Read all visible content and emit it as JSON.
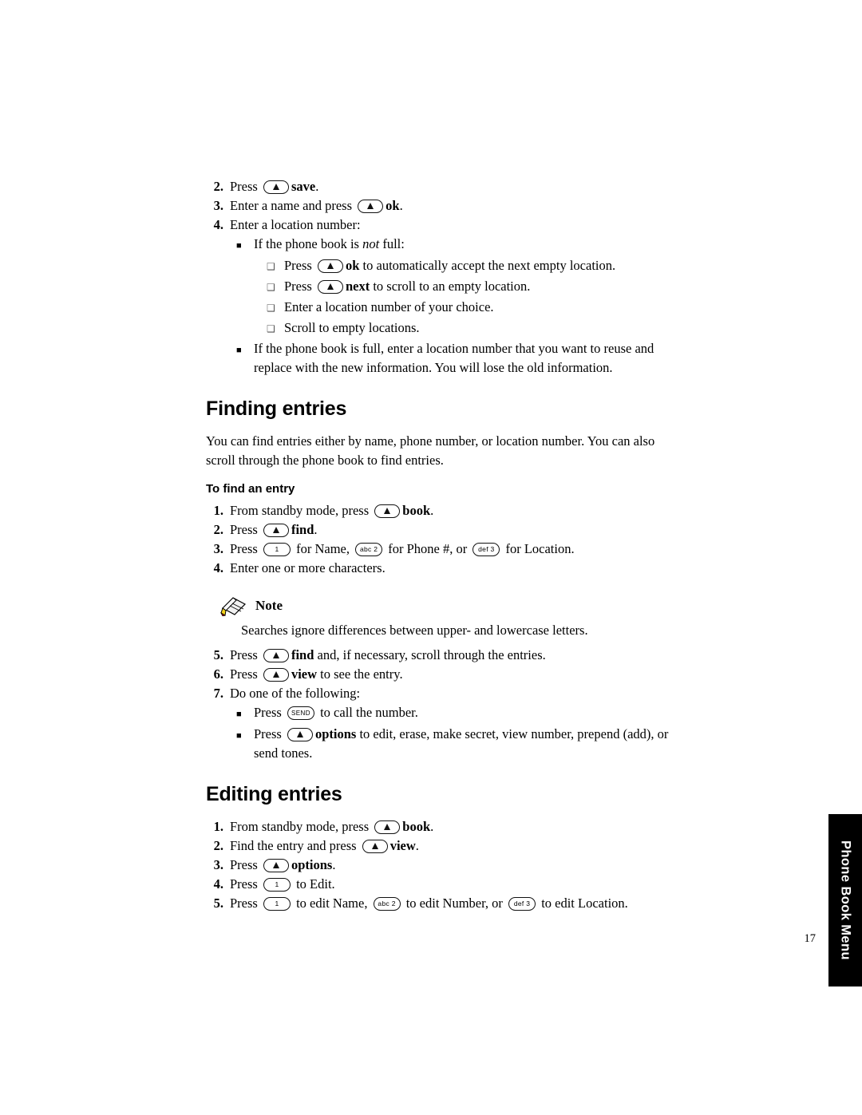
{
  "page": {
    "number": "17",
    "side_tab_label": "Phone Book Menu"
  },
  "steps_top": [
    {
      "num": "2.",
      "pre": "Press",
      "key": "nav",
      "bold": "save",
      "post": "."
    },
    {
      "num": "3.",
      "pre": "Enter a name and press",
      "key": "nav",
      "bold": "ok",
      "post": "."
    },
    {
      "num": "4.",
      "pre": "Enter a location number:",
      "key": "",
      "bold": "",
      "post": ""
    }
  ],
  "sub_bullets": [
    {
      "type": "square",
      "text_pre": "If the phone book is ",
      "text_italic": "not",
      "text_post": " full:"
    },
    {
      "type": "check",
      "pre": "Press",
      "key": "nav",
      "bold": "ok",
      "post": " to automatically accept the next empty location."
    },
    {
      "type": "check",
      "pre": "Press",
      "key": "nav",
      "bold": "next",
      "post": " to scroll to an empty location."
    },
    {
      "type": "check",
      "pre": "Enter a location number of your choice.",
      "key": "",
      "bold": "",
      "post": ""
    },
    {
      "type": "check",
      "pre": "Scroll to empty locations.",
      "key": "",
      "bold": "",
      "post": ""
    },
    {
      "type": "square",
      "text_pre": "If the phone book is full, enter a location number that you want to reuse and replace with the new information. You will lose the old information.",
      "text_italic": "",
      "text_post": ""
    }
  ],
  "finding": {
    "heading": "Finding entries",
    "intro": "You can find entries either by name, phone number, or location number. You can also scroll through the phone book to find entries.",
    "subheading": "To find an entry",
    "steps": [
      {
        "num": "1.",
        "pre": "From standby mode, press",
        "key": "nav",
        "bold": "book",
        "post": "."
      },
      {
        "num": "2.",
        "pre": "Press",
        "key": "nav",
        "bold": "find",
        "post": "."
      },
      {
        "num": "3.",
        "pre": "Press",
        "key": "key1",
        "bold": "",
        "post": " for Name,",
        "key2": "abc2",
        "mid": " for Phone #, or",
        "key3": "def3",
        "tail": " for Location."
      },
      {
        "num": "4.",
        "pre": "Enter one or more characters.",
        "key": "",
        "bold": "",
        "post": ""
      }
    ],
    "note": {
      "title": "Note",
      "body": "Searches ignore differences between upper- and lowercase letters."
    },
    "steps_after": [
      {
        "num": "5.",
        "pre": "Press",
        "key": "nav",
        "bold": "find",
        "post": " and, if necessary, scroll through the entries."
      },
      {
        "num": "6.",
        "pre": "Press",
        "key": "nav",
        "bold": "view",
        "post": " to see the entry."
      },
      {
        "num": "7.",
        "pre": "Do one of the following:",
        "key": "",
        "bold": "",
        "post": ""
      }
    ],
    "final_bullets": [
      {
        "pre": "Press",
        "key": "send",
        "bold": "",
        "post": " to call the number."
      },
      {
        "pre": "Press",
        "key": "nav",
        "bold": "options",
        "post": " to edit, erase, make secret, view number, prepend (add), or send tones."
      }
    ]
  },
  "editing": {
    "heading": "Editing entries",
    "steps": [
      {
        "num": "1.",
        "pre": "From standby mode, press",
        "key": "nav",
        "bold": "book",
        "post": "."
      },
      {
        "num": "2.",
        "pre": "Find the entry and press",
        "key": "nav",
        "bold": "view",
        "post": "."
      },
      {
        "num": "3.",
        "pre": "Press",
        "key": "nav",
        "bold": "options",
        "post": "."
      },
      {
        "num": "4.",
        "pre": "Press",
        "key": "key1",
        "bold": "",
        "post": " to Edit."
      },
      {
        "num": "5.",
        "pre": "Press",
        "key": "key1",
        "bold": "",
        "post": " to edit Name,",
        "key2": "abc2",
        "mid": " to edit Number, or",
        "key3": "def3",
        "tail": " to edit Location."
      }
    ]
  },
  "keys": {
    "nav_label": "",
    "key1_label": "1",
    "abc2_label": "abc 2",
    "def3_label": "def 3",
    "send_label": "SEND"
  }
}
